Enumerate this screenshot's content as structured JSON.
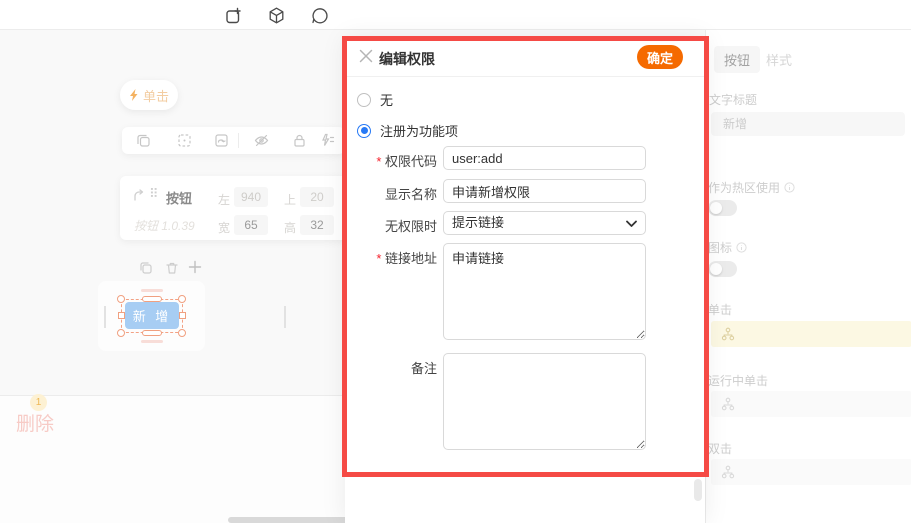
{
  "topbar": {
    "icons": [
      "export",
      "component",
      "comment"
    ]
  },
  "canvas": {
    "click_pill_label": "单击",
    "widget_bar": {
      "name": "按钮",
      "meta": "按钮 1.0.39",
      "pos": [
        {
          "k": "左",
          "v": "940"
        },
        {
          "k": "上",
          "v": "20"
        },
        {
          "k": "宽",
          "v": "65"
        },
        {
          "k": "高",
          "v": "32"
        }
      ]
    },
    "button_label": "新 增",
    "delete_badge": "1",
    "delete_label": "删除"
  },
  "modal": {
    "title": "编辑权限",
    "confirm_label": "确定",
    "radios": [
      {
        "label": "无",
        "selected": false
      },
      {
        "label": "注册为功能项",
        "selected": true
      }
    ],
    "fields": [
      {
        "label": "权限代码",
        "required": true,
        "type": "input",
        "value": "user:add"
      },
      {
        "label": "显示名称",
        "required": false,
        "type": "input",
        "value": "申请新增权限"
      },
      {
        "label": "无权限时",
        "required": false,
        "type": "select",
        "value": "提示链接"
      },
      {
        "label": "链接地址",
        "required": true,
        "type": "textarea",
        "value": "申请链接"
      },
      {
        "label": "备注",
        "required": false,
        "type": "textarea",
        "value": ""
      }
    ]
  },
  "panel": {
    "tabs": [
      {
        "label": "按钮",
        "active": true
      },
      {
        "label": "样式",
        "active": false
      }
    ],
    "text_title_label": "文字标题",
    "text_title_value": "新增",
    "hotspot_label": "作为热区使用",
    "hotspot_on": false,
    "icon_label": "图标",
    "icon_on": false,
    "click_label": "单击",
    "running_click_label": "运行中单击",
    "dblclick_label": "双击"
  },
  "colors": {
    "red_frame": "#f54a45",
    "confirm_orange": "#f56a00",
    "radio_blue": "#2779f5",
    "widget_blue": "#a7cdf3",
    "selection_orange": "#f3a184",
    "event_row_yellow": "#fcf8e3"
  }
}
